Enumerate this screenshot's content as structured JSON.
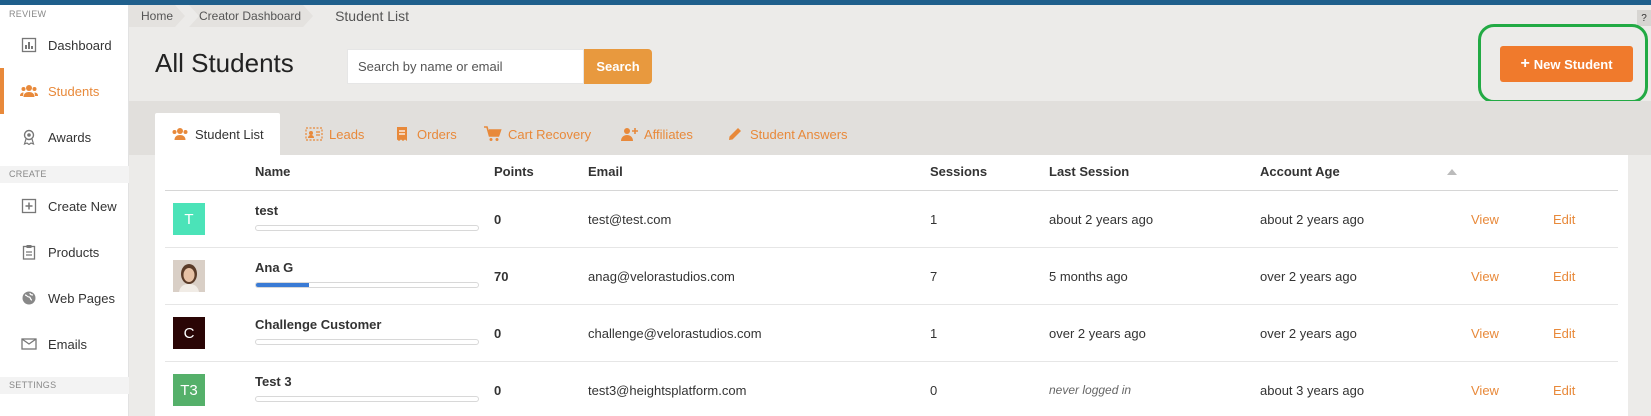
{
  "sidebar": {
    "sections": [
      {
        "label": "REVIEW"
      },
      {
        "label": "CREATE"
      },
      {
        "label": "SETTINGS"
      }
    ],
    "items": [
      {
        "label": "Dashboard",
        "icon": "chart-icon"
      },
      {
        "label": "Students",
        "icon": "users-icon",
        "active": true
      },
      {
        "label": "Awards",
        "icon": "award-icon"
      },
      {
        "label": "Create New",
        "icon": "plus-square-icon"
      },
      {
        "label": "Products",
        "icon": "clipboard-icon"
      },
      {
        "label": "Web Pages",
        "icon": "globe-icon"
      },
      {
        "label": "Emails",
        "icon": "email-icon"
      }
    ]
  },
  "breadcrumb": [
    "Home",
    "Creator Dashboard",
    "Student List"
  ],
  "help_label": "?",
  "header": {
    "title": "All Students",
    "search_placeholder": "Search by name or email",
    "search_button": "Search",
    "new_button": "New Student"
  },
  "tabs": [
    {
      "label": "Student List",
      "icon": "users-icon",
      "active": true
    },
    {
      "label": "Leads",
      "icon": "address-card-icon"
    },
    {
      "label": "Orders",
      "icon": "receipt-icon"
    },
    {
      "label": "Cart Recovery",
      "icon": "cart-icon"
    },
    {
      "label": "Affiliates",
      "icon": "user-plus-icon"
    },
    {
      "label": "Student Answers",
      "icon": "pencil-icon"
    }
  ],
  "table": {
    "columns": [
      "Name",
      "Points",
      "Email",
      "Sessions",
      "Last Session",
      "Account Age"
    ],
    "rows": [
      {
        "avatar_text": "T",
        "avatar_color": "#4be3b8",
        "name": "test",
        "points": "0",
        "progress": 0,
        "email": "test@test.com",
        "sessions": "1",
        "last_session": "about 2 years ago",
        "account_age": "about 2 years ago",
        "view": "View",
        "edit": "Edit"
      },
      {
        "avatar_text": "",
        "avatar_color": "#c9a890",
        "photo": true,
        "name": "Ana G",
        "points": "70",
        "progress": 0.24,
        "email": "anag@velorastudios.com",
        "sessions": "7",
        "last_session": "5 months ago",
        "account_age": "over 2 years ago",
        "view": "View",
        "edit": "Edit"
      },
      {
        "avatar_text": "C",
        "avatar_color": "#2a0505",
        "name": "Challenge Customer",
        "points": "0",
        "progress": 0,
        "email": "challenge@velorastudios.com",
        "sessions": "1",
        "last_session": "over 2 years ago",
        "account_age": "over 2 years ago",
        "view": "View",
        "edit": "Edit"
      },
      {
        "avatar_text": "T3",
        "avatar_color": "#55b06a",
        "name": "Test 3",
        "points": "0",
        "progress": 0,
        "email": "test3@heightsplatform.com",
        "sessions": "0",
        "last_session": "never logged in",
        "last_session_italic": true,
        "account_age": "about 3 years ago",
        "view": "View",
        "edit": "Edit"
      }
    ]
  },
  "colors": {
    "accent": "#e8893a",
    "primary_button": "#f07a2c",
    "highlight_box": "#22aa44",
    "topbar": "#1f5f8c"
  }
}
